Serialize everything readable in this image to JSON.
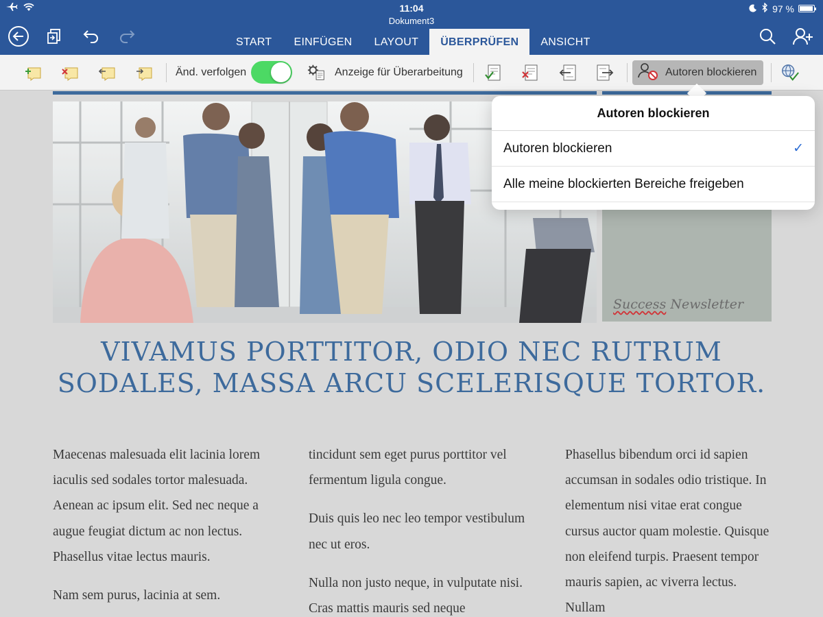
{
  "status": {
    "time": "11:04",
    "battery_text": "97 %",
    "battery_level": 0.97
  },
  "document": {
    "title": "Dokument3",
    "headline": "Vivamus porttitor, odio nec rutrum sodales, massa arcu scelerisque tortor.",
    "newsletter": {
      "word1": "Success",
      "word2": "Newsletter"
    },
    "columns": [
      [
        "Maecenas malesuada elit lacinia lorem iaculis sed sodales tortor malesuada. Aenean ac ipsum elit. Sed nec neque a augue feugiat dictum ac non lectus. Phasellus vitae lectus mauris.",
        "Nam sem purus, lacinia at sem."
      ],
      [
        "tincidunt sem eget purus porttitor vel fermentum ligula congue.",
        "Duis quis leo nec leo tempor vestibulum nec ut eros.",
        "Nulla non justo neque, in vulputate nisi. Cras mattis mauris sed neque"
      ],
      [
        "Phasellus bibendum orci id sapien accumsan in sodales odio tristique. In elementum nisi vitae erat congue cursus auctor quam molestie. Quisque non eleifend turpis.  Praesent tempor mauris sapien, ac viverra lectus. Nullam"
      ]
    ]
  },
  "tabs": [
    {
      "label": "START",
      "active": false
    },
    {
      "label": "EINFÜGEN",
      "active": false
    },
    {
      "label": "LAYOUT",
      "active": false
    },
    {
      "label": "ÜBERPRÜFEN",
      "active": true
    },
    {
      "label": "ANSICHT",
      "active": false
    }
  ],
  "ribbon": {
    "track_changes_label": "Änd. verfolgen",
    "track_changes_on": true,
    "markup_label": "Anzeige für Überarbeitung",
    "block_authors_label": "Autoren blockieren"
  },
  "popover": {
    "title": "Autoren blockieren",
    "items": [
      {
        "label": "Autoren blockieren",
        "checked": true,
        "check_glyph": "✓"
      },
      {
        "label": "Alle meine blockierten Bereiche freigeben",
        "checked": false
      }
    ]
  },
  "colors": {
    "app_blue": "#2b579a",
    "heading_blue": "#3d6a9c",
    "toggle_green": "#4cd964",
    "check_blue": "#2b6cd4"
  }
}
